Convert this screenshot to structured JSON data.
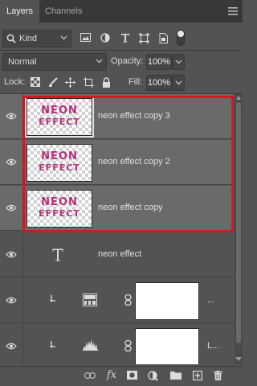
{
  "tabs": [
    {
      "label": "Layers",
      "active": true
    },
    {
      "label": "Channels",
      "active": false
    }
  ],
  "filter": {
    "kind_label": "Kind",
    "icons": [
      "image-filter-icon",
      "adjustment-filter-icon",
      "type-filter-icon",
      "shape-filter-icon",
      "smart-object-filter-icon",
      "filter-toggle-icon"
    ]
  },
  "blend": {
    "mode": "Normal",
    "opacity_label": "Opacity:",
    "opacity_value": "100%",
    "fill_label": "Fill:",
    "fill_value": "100%"
  },
  "lock": {
    "label": "Lock:",
    "icons": [
      "lock-transparent-icon",
      "lock-image-icon",
      "lock-position-icon",
      "lock-artboard-icon",
      "lock-all-icon"
    ]
  },
  "layers": [
    {
      "name": "neon effect copy 3",
      "type": "raster",
      "selected": true,
      "thumb_line1": "NEON",
      "thumb_line2": "EFFECT"
    },
    {
      "name": "neon effect copy 2",
      "type": "raster",
      "selected": true,
      "thumb_line1": "NEON",
      "thumb_line2": "EFFECT"
    },
    {
      "name": "neon effect copy",
      "type": "raster",
      "selected": true,
      "thumb_line1": "NEON",
      "thumb_line2": "EFFECT"
    },
    {
      "name": "neon effect",
      "type": "text",
      "selected": false
    },
    {
      "name": "...",
      "type": "gradient-map-adjustment",
      "selected": false
    },
    {
      "name": "L...",
      "type": "levels-adjustment",
      "selected": false
    }
  ],
  "footer_icons": [
    "link-layers-icon",
    "fx-icon",
    "add-mask-icon",
    "new-adjustment-icon",
    "new-group-icon",
    "new-layer-icon",
    "delete-icon"
  ],
  "colors": {
    "panel": "#535353",
    "selected_row": "#6a6a6a",
    "highlight": "#d3181f",
    "neon_text": "#b5307a"
  }
}
